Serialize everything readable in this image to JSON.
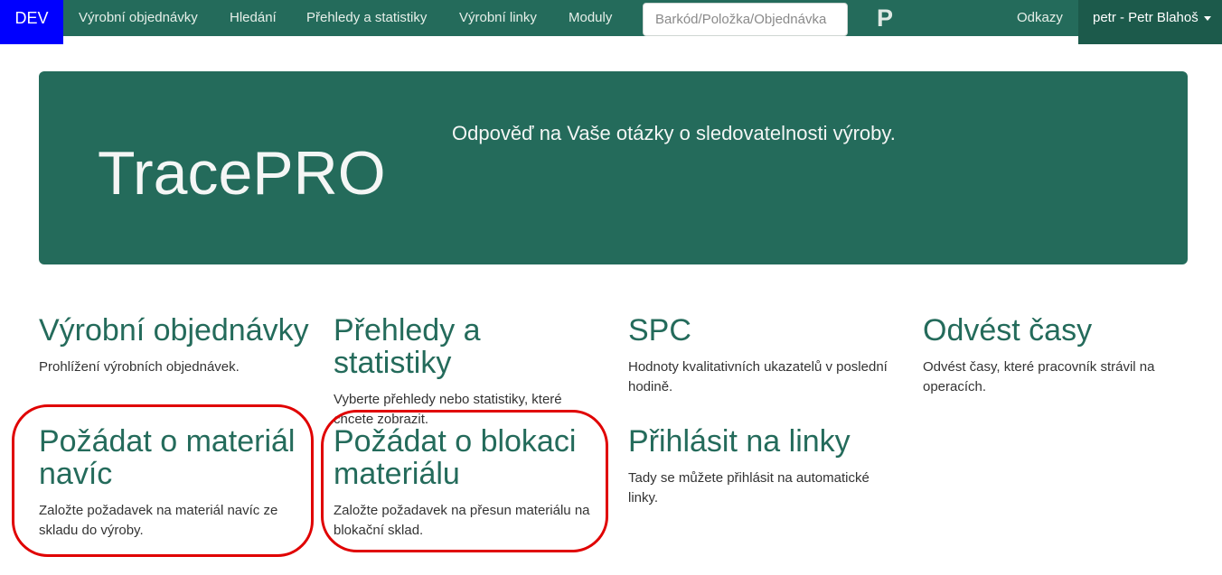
{
  "nav": {
    "brand": "DEV",
    "items": [
      {
        "label": "Výrobní objednávky"
      },
      {
        "label": "Hledání"
      },
      {
        "label": "Přehledy a statistiky"
      },
      {
        "label": "Výrobní linky"
      },
      {
        "label": "Moduly"
      }
    ],
    "search_placeholder": "Barkód/Položka/Objednávka",
    "logo": "P",
    "links": "Odkazy",
    "user": "petr - Petr Blahoš"
  },
  "jumbotron": {
    "title": "TracePRO",
    "subtitle": "Odpověď na Vaše otázky o sledovatelnosti výroby."
  },
  "cards": [
    {
      "title": "Výrobní objednávky",
      "text": "Prohlížení výrobních objednávek."
    },
    {
      "title": "Přehledy a statistiky",
      "text": "Vyberte přehledy nebo statistiky, které chcete zobrazit."
    },
    {
      "title": "SPC",
      "text": "Hodnoty kvalitativních ukazatelů v poslední hodině."
    },
    {
      "title": "Odvést časy",
      "text": "Odvést časy, které pracovník strávil na operacích."
    },
    {
      "title": "Požádat o materiál navíc",
      "text": "Založte požadavek na materiál navíc ze skladu do výroby."
    },
    {
      "title": "Požádat o blokaci materiálu",
      "text": "Založte požadavek na přesun materiálu na blokační sklad."
    },
    {
      "title": "Přihlásit na linky",
      "text": "Tady se můžete přihlásit na automatické linky."
    }
  ],
  "colors": {
    "primary": "#246b5b",
    "brand": "#0000ff",
    "highlight": "#e00000"
  }
}
